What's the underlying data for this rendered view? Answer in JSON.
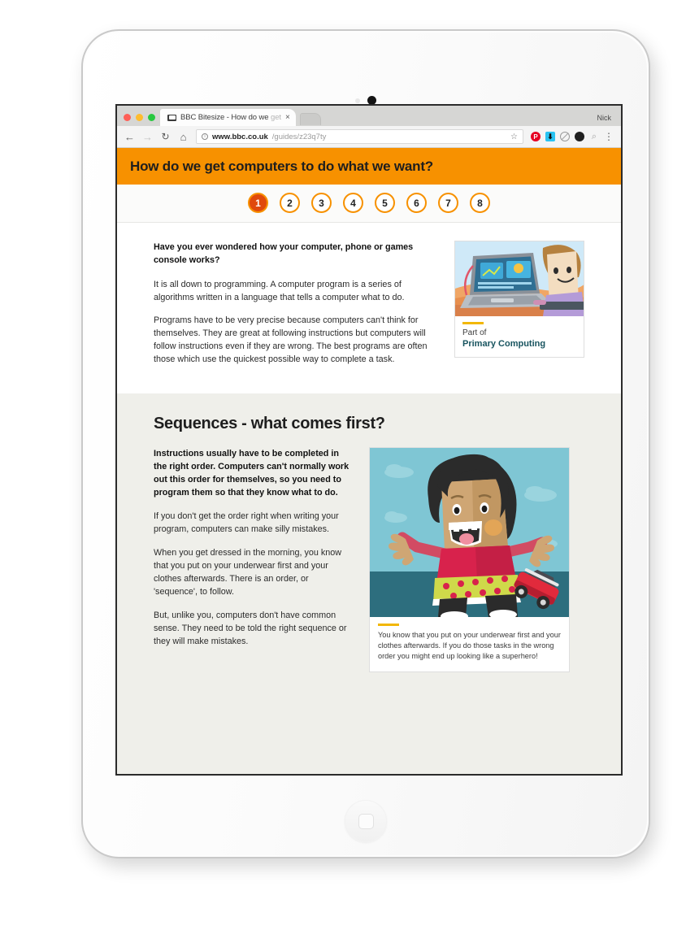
{
  "browser": {
    "profile_name": "Nick",
    "tab": {
      "title_visible": "BBC Bitesize - How do we ",
      "title_faded": "get",
      "close_label": "×",
      "favicon_name": "bbc-favicon"
    },
    "toolbar": {
      "back_icon": "←",
      "forward_icon": "→",
      "reload_icon": "↻",
      "home_icon": "⌂",
      "info_icon": "i",
      "url_domain": "www.bbc.co.uk",
      "url_path": "/guides/z23q7ty",
      "url_full": "www.bbc.co.uk/guides/z23q7ty",
      "star_icon": "☆",
      "pinterest_icon": "P",
      "download_icon": "⬇",
      "block_icon": "",
      "solid_icon": "",
      "search_icon": "⌕",
      "menu_icon": "⋮"
    }
  },
  "page": {
    "header_title": "How do we get computers to do what we want?",
    "pagination": [
      {
        "label": "1",
        "active": true
      },
      {
        "label": "2",
        "active": false
      },
      {
        "label": "3",
        "active": false
      },
      {
        "label": "4",
        "active": false
      },
      {
        "label": "5",
        "active": false
      },
      {
        "label": "6",
        "active": false
      },
      {
        "label": "7",
        "active": false
      },
      {
        "label": "8",
        "active": false
      }
    ],
    "intro": {
      "lead": "Have you ever wondered how your computer, phone or games console works?",
      "para1": "It is all down to programming. A computer program is a series of algorithms written in a language that tells a computer what to do.",
      "para2": "Programs have to be very precise because computers can't think for themselves. They are great at following instructions but computers will follow instructions even if they are wrong. The best programs are often those which use the quickest possible way to complete a task."
    },
    "part_of": {
      "label": "Part of",
      "title": "Primary Computing",
      "thumb_name": "laptop-character-illustration"
    },
    "sequences": {
      "title": "Sequences - what comes first?",
      "lead": "Instructions usually have to be completed in the right order. Computers can't normally work out this order for themselves, so you need to program them so that they know what to do.",
      "para1": "If you don't get the order right when writing your program, computers can make silly mistakes.",
      "para2": "When you get dressed in the morning, you know that you put on your underwear first and your clothes afterwards. There is an order, or 'sequence', to follow.",
      "para3": "But, unlike you, computers don't have common sense. They need to be told the right sequence or they will make mistakes.",
      "figure_caption": "You know that you put on your underwear first and your clothes afterwards. If you do those tasks in the wrong order you might end up looking like a superhero!",
      "figure_name": "superhero-underwear-illustration"
    }
  },
  "colors": {
    "brand_orange": "#F79100",
    "active_pagination": "#E0490C",
    "section_bg": "#EFEFEA",
    "link_teal": "#18545F",
    "gold_rule": "#F2B705"
  }
}
